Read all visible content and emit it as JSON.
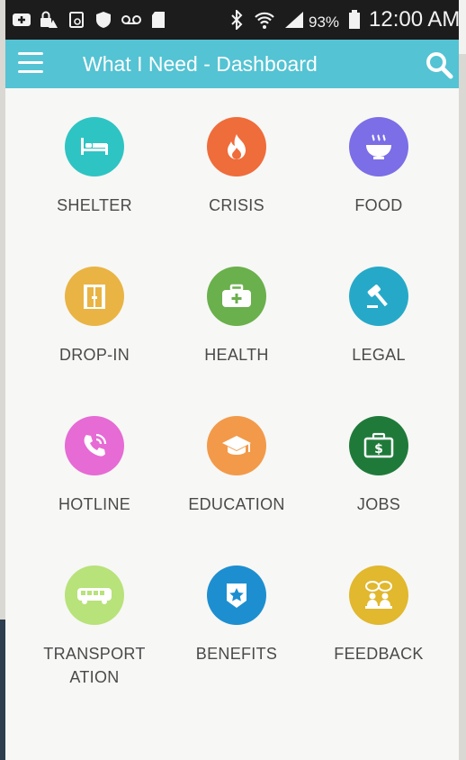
{
  "status_bar": {
    "battery_percent": "93%",
    "time": "12:00 AM"
  },
  "app_bar": {
    "title": "What I Need - Dashboard"
  },
  "dashboard": {
    "items": [
      {
        "label": "SHELTER",
        "icon": "bed-icon",
        "color": "#2ec4c3"
      },
      {
        "label": "CRISIS",
        "icon": "fire-icon",
        "color": "#ef6c3b"
      },
      {
        "label": "FOOD",
        "icon": "soup-bowl-icon",
        "color": "#7b6ee6"
      },
      {
        "label": "DROP-IN",
        "icon": "door-icon",
        "color": "#e9b444"
      },
      {
        "label": "HEALTH",
        "icon": "first-aid-kit-icon",
        "color": "#6ab04c"
      },
      {
        "label": "LEGAL",
        "icon": "gavel-icon",
        "color": "#26a9c8"
      },
      {
        "label": "HOTLINE",
        "icon": "phone-icon",
        "color": "#e66bd4"
      },
      {
        "label": "EDUCATION",
        "icon": "graduation-cap-icon",
        "color": "#f29a4a"
      },
      {
        "label": "JOBS",
        "icon": "briefcase-dollar-icon",
        "color": "#1f7a3a"
      },
      {
        "label": "TRANSPORT\nATION",
        "icon": "bus-icon",
        "color": "#b8e27a"
      },
      {
        "label": "BENEFITS",
        "icon": "star-badge-icon",
        "color": "#1d8fd0"
      },
      {
        "label": "FEEDBACK",
        "icon": "speech-people-icon",
        "color": "#e1b82e"
      }
    ]
  }
}
